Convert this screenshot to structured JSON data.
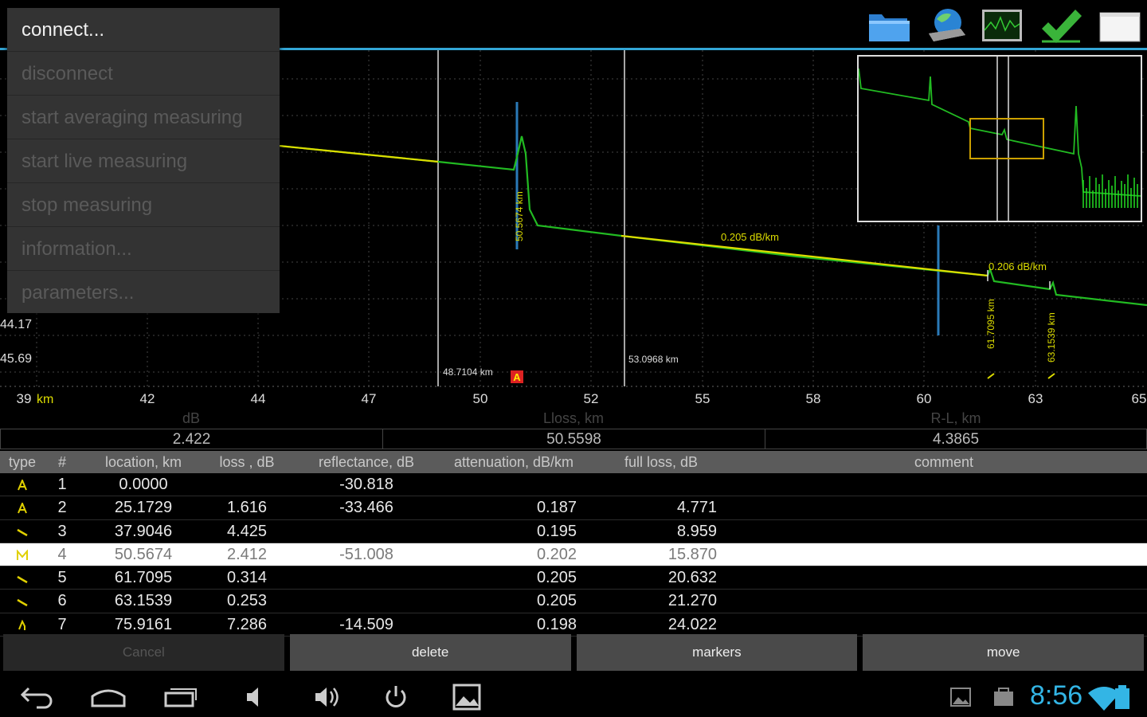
{
  "menu": {
    "items": [
      {
        "label": "connect...",
        "enabled": true
      },
      {
        "label": "disconnect",
        "enabled": false
      },
      {
        "label": "start averaging measuring",
        "enabled": false
      },
      {
        "label": "start live measuring",
        "enabled": false
      },
      {
        "label": "stop measuring",
        "enabled": false
      },
      {
        "label": "information...",
        "enabled": false
      },
      {
        "label": "parameters...",
        "enabled": false
      }
    ]
  },
  "toolbar": {
    "icons": [
      "folder-icon",
      "network-drive-icon",
      "trace-monitor-icon",
      "checkmark-icon",
      "window-icon"
    ]
  },
  "graph": {
    "y_labels": [
      "44.17",
      "45.69"
    ],
    "x_ticks": [
      "39",
      "42",
      "44",
      "47",
      "50",
      "52",
      "55",
      "58",
      "60",
      "63",
      "65"
    ],
    "x_unit": "km",
    "cursor_left_label": "48.7104 km",
    "cursor_right_label": "53.0968 km",
    "event_label_1": "50.5674 km",
    "event_label_2": "61.7095 km",
    "event_label_3": "63.1539 km",
    "slope_label_1": "0.205 dB/km",
    "slope_label_2": "0.206 dB/km",
    "marker_A": "A",
    "cursor_lines": [
      48.7104,
      53.0968
    ],
    "trace_color": "#22bb22",
    "fit_color": "#dddd00"
  },
  "summary": {
    "labels": [
      "dB",
      "Lloss, km",
      "R-L, km"
    ],
    "values": [
      "2.422",
      "50.5598",
      "4.3865"
    ]
  },
  "table": {
    "headers": [
      "type",
      "#",
      "location, km",
      "loss , dB",
      "reflectance, dB",
      "attenuation, dB/km",
      "full loss, dB",
      "comment"
    ],
    "rows": [
      {
        "type": "A",
        "num": "1",
        "loc": "0.0000",
        "loss": "",
        "refl": "-30.818",
        "att": "",
        "full": "",
        "comment": ""
      },
      {
        "type": "A",
        "num": "2",
        "loc": "25.1729",
        "loss": "1.616",
        "refl": "-33.466",
        "att": "0.187",
        "full": "4.771",
        "comment": ""
      },
      {
        "type": "splice",
        "num": "3",
        "loc": "37.9046",
        "loss": "4.425",
        "refl": "",
        "att": "0.195",
        "full": "8.959",
        "comment": ""
      },
      {
        "type": "M",
        "num": "4",
        "loc": "50.5674",
        "loss": "2.412",
        "refl": "-51.008",
        "att": "0.202",
        "full": "15.870",
        "comment": ""
      },
      {
        "type": "splice",
        "num": "5",
        "loc": "61.7095",
        "loss": "0.314",
        "refl": "",
        "att": "0.205",
        "full": "20.632",
        "comment": ""
      },
      {
        "type": "splice",
        "num": "6",
        "loc": "63.1539",
        "loss": "0.253",
        "refl": "",
        "att": "0.205",
        "full": "21.270",
        "comment": ""
      },
      {
        "type": "end",
        "num": "7",
        "loc": "75.9161",
        "loss": "7.286",
        "refl": "-14.509",
        "att": "0.198",
        "full": "24.022",
        "comment": ""
      }
    ],
    "selected_index": 3
  },
  "actions": {
    "cancel": "Cancel",
    "delete": "delete",
    "markers": "markers",
    "move": "move"
  },
  "status": {
    "time": "8:56"
  }
}
